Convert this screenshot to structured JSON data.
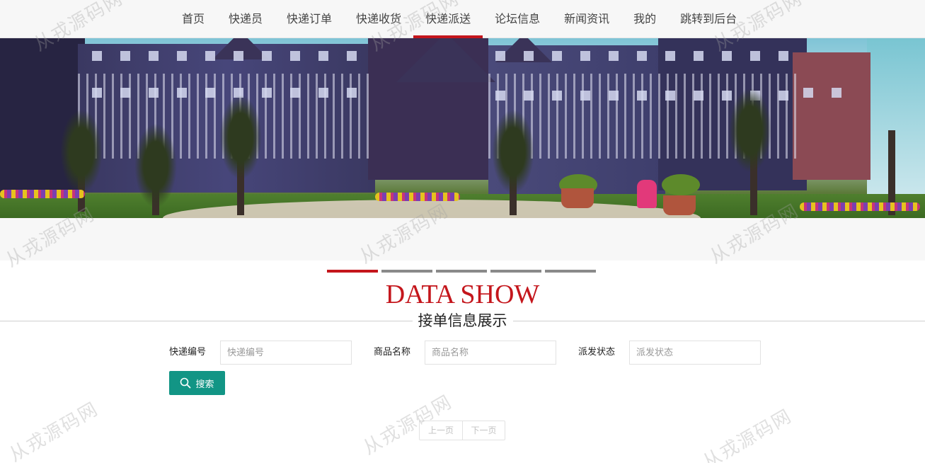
{
  "nav": {
    "items": [
      "首页",
      "快递员",
      "快递订单",
      "快递收货",
      "快递派送",
      "论坛信息",
      "新闻资讯",
      "我的",
      "跳转到后台"
    ],
    "active_index": 4,
    "active_color": "#c4161c"
  },
  "banner": {
    "slide_count": 5,
    "active_slide": 0
  },
  "heading": {
    "title_en": "DATA SHOW",
    "title_cn": "接单信息展示",
    "accent_color": "#c4161c"
  },
  "search": {
    "fields": [
      {
        "label": "快递编号",
        "placeholder": "快递编号",
        "value": ""
      },
      {
        "label": "商品名称",
        "placeholder": "商品名称",
        "value": ""
      },
      {
        "label": "派发状态",
        "placeholder": "派发状态",
        "value": ""
      }
    ],
    "button_label": "搜索",
    "button_icon": "search-icon",
    "button_color": "#129585"
  },
  "pager": {
    "prev_label": "上一页",
    "next_label": "下一页"
  },
  "watermark": {
    "text": "从戎源码网"
  }
}
